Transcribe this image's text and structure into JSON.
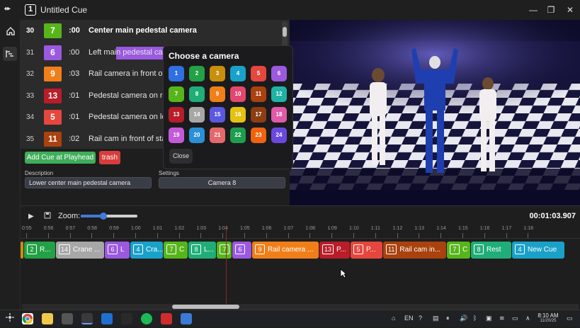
{
  "window": {
    "logo": "⬰",
    "cue_number": "1",
    "title": "Untitled Cue",
    "minimize": "—",
    "restore": "❐",
    "close": "✕"
  },
  "rail": {
    "home_icon": "home-icon",
    "cues_icon": "timeline-icon"
  },
  "cue_rows": [
    {
      "num": "30",
      "cam": "7",
      "color": "#57b51b",
      "dur": ":00",
      "desc": "Center main pedestal camera",
      "active": true
    },
    {
      "num": "31",
      "cam": "6",
      "color": "#9b59e0",
      "dur": ":00",
      "desc": "Left main pedestal ca",
      "active": false
    },
    {
      "num": "32",
      "cam": "9",
      "color": "#f07f1a",
      "dur": ":03",
      "desc": "Rail camera in front o",
      "active": false
    },
    {
      "num": "33",
      "cam": "13",
      "color": "#b81d29",
      "dur": ":01",
      "desc": "Pedestal camera on ri",
      "active": false
    },
    {
      "num": "34",
      "cam": "5",
      "color": "#e5463d",
      "dur": ":01",
      "desc": "Pedestal camera on le",
      "active": false
    },
    {
      "num": "35",
      "cam": "11",
      "color": "#a9420f",
      "dur": ":02",
      "desc": "Rail cam in front of sta",
      "active": false
    }
  ],
  "actions": {
    "add_cue": "Add Cue at Playhead",
    "trash": "trash"
  },
  "description": {
    "label": "Description",
    "value": "Lower center main pedestal camera"
  },
  "settings": {
    "label": "Settings",
    "value": "Camera 8"
  },
  "popup": {
    "title": "Choose a camera",
    "close": "Close",
    "cameras": [
      {
        "n": "1",
        "color": "#2f6fe0"
      },
      {
        "n": "2",
        "color": "#22a146"
      },
      {
        "n": "3",
        "color": "#c98e0b"
      },
      {
        "n": "4",
        "color": "#1aa1c9"
      },
      {
        "n": "5",
        "color": "#e5463d"
      },
      {
        "n": "6",
        "color": "#9b59e0"
      },
      {
        "n": "7",
        "color": "#57b51b"
      },
      {
        "n": "8",
        "color": "#1fae78"
      },
      {
        "n": "9",
        "color": "#f07f1a"
      },
      {
        "n": "10",
        "color": "#e2486f"
      },
      {
        "n": "11",
        "color": "#a9420f"
      },
      {
        "n": "12",
        "color": "#1fb3a6"
      },
      {
        "n": "13",
        "color": "#b81d29"
      },
      {
        "n": "14",
        "color": "#a7a7a7"
      },
      {
        "n": "15",
        "color": "#5b57e0"
      },
      {
        "n": "16",
        "color": "#e3c212"
      },
      {
        "n": "17",
        "color": "#8c3d12"
      },
      {
        "n": "18",
        "color": "#e05aa7"
      },
      {
        "n": "19",
        "color": "#c45ad8"
      },
      {
        "n": "20",
        "color": "#2a8fd6"
      },
      {
        "n": "21",
        "color": "#e3696b"
      },
      {
        "n": "22",
        "color": "#1e9e4c"
      },
      {
        "n": "23",
        "color": "#ef6210"
      },
      {
        "n": "24",
        "color": "#6a48df"
      }
    ]
  },
  "transport": {
    "play": "▶",
    "save": "💾",
    "zoom_label": "Zoom:",
    "zoom_level": 0.4,
    "time": "00:01:03.907"
  },
  "ruler_ticks": [
    "0:55",
    "0:56",
    "0:57",
    "0:58",
    "0:59",
    "1:00",
    "1:01",
    "1:02",
    "1:03",
    "1:04",
    "1:05",
    "1:06",
    "1:07",
    "1:08",
    "1:09",
    "1:10",
    "1:11",
    "1:12",
    "1:13",
    "1:14",
    "1:15",
    "1:16",
    "1:17",
    "1:18"
  ],
  "clips": [
    {
      "cam": "",
      "label": "",
      "color": "#c98e0b"
    },
    {
      "cam": "2",
      "label": "R...",
      "color": "#22a146"
    },
    {
      "cam": "14",
      "label": "Crane ...",
      "color": "#a7a7a7"
    },
    {
      "cam": "6",
      "label": "L",
      "color": "#9b59e0"
    },
    {
      "cam": "4",
      "label": "Cra...",
      "color": "#1aa1c9"
    },
    {
      "cam": "7",
      "label": "C",
      "color": "#57b51b"
    },
    {
      "cam": "8",
      "label": "L...",
      "color": "#1fae78"
    },
    {
      "cam": "7",
      "label": "",
      "color": "#57b51b"
    },
    {
      "cam": "6",
      "label": "",
      "color": "#9b59e0"
    },
    {
      "cam": "9",
      "label": "Rail camera ...",
      "color": "#f07f1a"
    },
    {
      "cam": "13",
      "label": "P...",
      "color": "#b81d29"
    },
    {
      "cam": "5",
      "label": "P...",
      "color": "#e5463d"
    },
    {
      "cam": "11",
      "label": "Rail cam in...",
      "color": "#a9420f"
    },
    {
      "cam": "7",
      "label": "C",
      "color": "#57b51b"
    },
    {
      "cam": "8",
      "label": "Rest",
      "color": "#1fae78"
    },
    {
      "cam": "4",
      "label": "New Cue",
      "color": "#1aa1c9"
    }
  ],
  "taskbar": {
    "lang": "EN",
    "time": "8:10 AM",
    "date": "11/20/25",
    "apps": [
      "chrome-icon",
      "file-explorer-icon",
      "calculator-icon",
      "app-icon",
      "store-icon",
      "terminal-icon",
      "spotify-icon",
      "app-red-icon",
      "monitor-icon"
    ]
  }
}
